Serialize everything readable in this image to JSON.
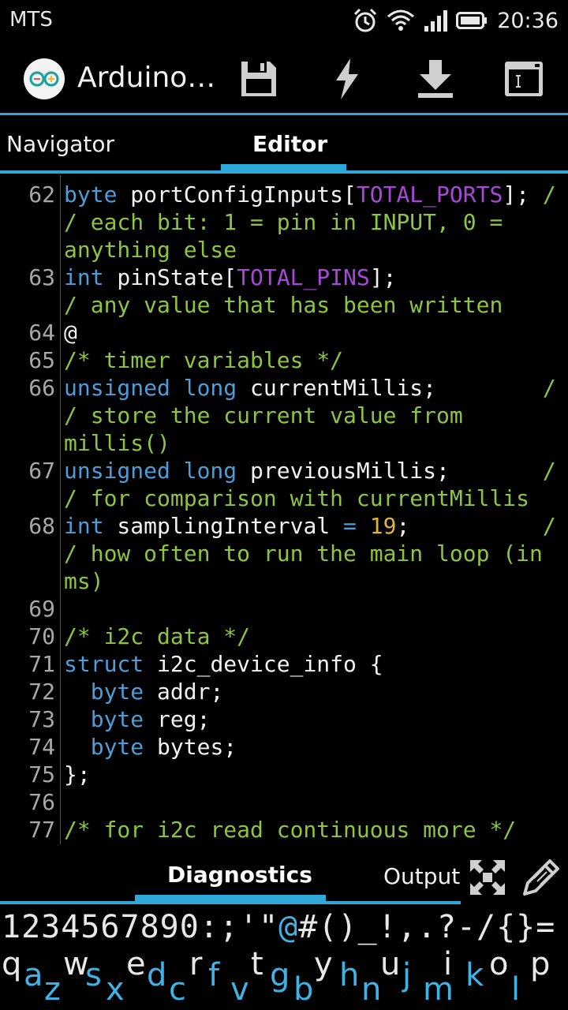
{
  "status": {
    "carrier": "MTS",
    "time": "20:36",
    "icons": [
      "alarm-icon",
      "wifi-icon",
      "signal-icon",
      "battery-icon"
    ]
  },
  "actionbar": {
    "title": "Arduino…",
    "buttons": [
      "save-icon",
      "flash-icon",
      "download-icon",
      "serial-monitor-icon"
    ]
  },
  "tabs": {
    "navigator": "Navigator",
    "editor": "Editor",
    "active": "Editor"
  },
  "editor_lines": [
    {
      "n": "62",
      "rows": [
        [
          {
            "t": "byte",
            "c": "kw"
          },
          {
            "t": " portConfigInputs[",
            "c": ""
          },
          {
            "t": "TOTAL_PORTS",
            "c": "cn"
          },
          {
            "t": "]; ",
            "c": ""
          },
          {
            "t": "/",
            "c": "cm"
          }
        ],
        [
          {
            "t": "/ each bit: 1 = pin in INPUT, 0 =",
            "c": "cm"
          }
        ],
        [
          {
            "t": "anything else",
            "c": "cm"
          }
        ]
      ]
    },
    {
      "n": "63",
      "rows": [
        [
          {
            "t": "int",
            "c": "kw"
          },
          {
            "t": " pinState[",
            "c": ""
          },
          {
            "t": "TOTAL_PINS",
            "c": "cn"
          },
          {
            "t": "];             ",
            "c": ""
          },
          {
            "t": "/",
            "c": "cm"
          }
        ],
        [
          {
            "t": "/ any value that has been written",
            "c": "cm"
          }
        ]
      ]
    },
    {
      "n": "64",
      "rows": [
        [
          {
            "t": "@",
            "c": ""
          }
        ]
      ]
    },
    {
      "n": "65",
      "rows": [
        [
          {
            "t": "/* timer variables */",
            "c": "cm"
          }
        ]
      ]
    },
    {
      "n": "66",
      "rows": [
        [
          {
            "t": "unsigned long",
            "c": "kw"
          },
          {
            "t": " currentMillis;        ",
            "c": ""
          },
          {
            "t": "/",
            "c": "cm"
          }
        ],
        [
          {
            "t": "/ store the current value from",
            "c": "cm"
          }
        ],
        [
          {
            "t": "millis()",
            "c": "cm"
          }
        ]
      ]
    },
    {
      "n": "67",
      "rows": [
        [
          {
            "t": "unsigned long",
            "c": "kw"
          },
          {
            "t": " previousMillis;       ",
            "c": ""
          },
          {
            "t": "/",
            "c": "cm"
          }
        ],
        [
          {
            "t": "/ for comparison with currentMillis",
            "c": "cm"
          }
        ]
      ]
    },
    {
      "n": "68",
      "rows": [
        [
          {
            "t": "int",
            "c": "kw"
          },
          {
            "t": " samplingInterval ",
            "c": ""
          },
          {
            "t": "=",
            "c": "kw"
          },
          {
            "t": " ",
            "c": ""
          },
          {
            "t": "19",
            "c": "nm"
          },
          {
            "t": ";          ",
            "c": ""
          },
          {
            "t": "/",
            "c": "cm"
          }
        ],
        [
          {
            "t": "/ how often to run the main loop (in",
            "c": "cm"
          }
        ],
        [
          {
            "t": "ms)",
            "c": "cm"
          }
        ]
      ]
    },
    {
      "n": "69",
      "rows": [
        [
          {
            "t": "",
            "c": ""
          }
        ]
      ]
    },
    {
      "n": "70",
      "rows": [
        [
          {
            "t": "/* i2c data */",
            "c": "cm"
          }
        ]
      ]
    },
    {
      "n": "71",
      "rows": [
        [
          {
            "t": "struct",
            "c": "kw"
          },
          {
            "t": " i2c_device_info {",
            "c": ""
          }
        ]
      ]
    },
    {
      "n": "72",
      "rows": [
        [
          {
            "t": "  ",
            "c": ""
          },
          {
            "t": "byte",
            "c": "kw"
          },
          {
            "t": " addr;",
            "c": ""
          }
        ]
      ]
    },
    {
      "n": "73",
      "rows": [
        [
          {
            "t": "  ",
            "c": ""
          },
          {
            "t": "byte",
            "c": "kw"
          },
          {
            "t": " reg;",
            "c": ""
          }
        ]
      ]
    },
    {
      "n": "74",
      "rows": [
        [
          {
            "t": "  ",
            "c": ""
          },
          {
            "t": "byte",
            "c": "kw"
          },
          {
            "t": " bytes;",
            "c": ""
          }
        ]
      ]
    },
    {
      "n": "75",
      "rows": [
        [
          {
            "t": "};",
            "c": ""
          }
        ]
      ]
    },
    {
      "n": "76",
      "rows": [
        [
          {
            "t": "",
            "c": ""
          }
        ]
      ]
    },
    {
      "n": "77",
      "rows": [
        [
          {
            "t": "/* for i2c read continuous more */",
            "c": "cm"
          }
        ]
      ]
    }
  ],
  "bottom_tabs": {
    "diagnostics": "Diagnostics",
    "output": "Output",
    "active": "Diagnostics",
    "buttons": [
      "expand-icon",
      "edit-icon"
    ]
  },
  "keyboard": {
    "symbols_pre": "1234567890:;'\"",
    "symbols_accent": "@",
    "symbols_post": "#()_!,.?-/{}=",
    "upper": [
      "q",
      "w",
      "e",
      "r",
      "t",
      "y",
      "u",
      "i",
      "o",
      "p"
    ],
    "lower": [
      "a",
      "z",
      "s",
      "x",
      "d",
      "c",
      "f",
      "v",
      "g",
      "b",
      "h",
      "n",
      "j",
      "m",
      "k",
      "l"
    ]
  },
  "colors": {
    "accent": "#2ea7d9",
    "keyword": "#4c9edb",
    "comment": "#8cc63f",
    "constant": "#a947d9",
    "number": "#e0b53a"
  }
}
